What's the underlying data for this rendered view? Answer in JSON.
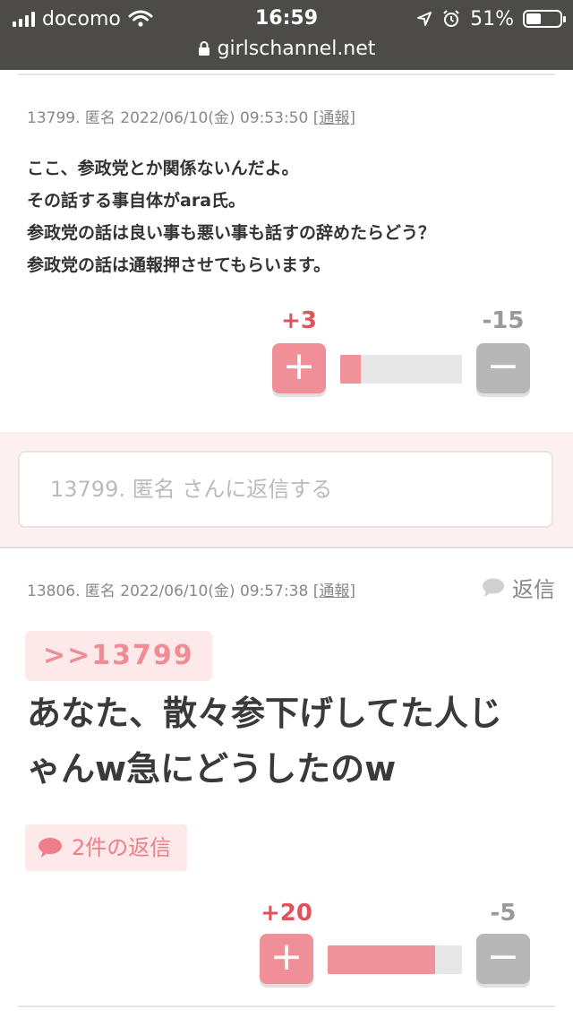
{
  "status_bar": {
    "carrier": "docomo",
    "time": "16:59",
    "battery": "51%",
    "url": "girlschannel.net"
  },
  "comment1": {
    "number": "13799.",
    "author": "匿名",
    "datetime": "2022/06/10(金) 09:53:50",
    "report_label": "通報",
    "lines": [
      "ここ、参政党とか関係ないんだよ。",
      "その話する事自体がara氏。",
      "参政党の話は良い事も悪い事も話すの辞めたらどう？",
      "参政党の話は通報押させてもらいます。"
    ],
    "plus_count": "+3",
    "minus_count": "-15",
    "plus_ratio": 0.17,
    "plus_symbol": "+",
    "minus_symbol": "−"
  },
  "reply_prompt": {
    "placeholder": "13799. 匿名 さんに返信する"
  },
  "comment2": {
    "number": "13806.",
    "author": "匿名",
    "datetime": "2022/06/10(金) 09:57:38",
    "report_label": "通報",
    "reply_label": "返信",
    "anchor": ">>13799",
    "lines": [
      "あなた、散々参下げしてた人じ",
      "ゃんw急にどうしたのw"
    ],
    "replies_label": "2件の返信",
    "plus_count": "+20",
    "minus_count": "-5",
    "plus_ratio": 0.8,
    "plus_symbol": "+",
    "minus_symbol": "−"
  },
  "colors": {
    "accent_pink": "#f08f97",
    "plus_red": "#e0525c",
    "minus_gray": "#b7b7b7",
    "reply_bg": "#fdf0f0"
  }
}
